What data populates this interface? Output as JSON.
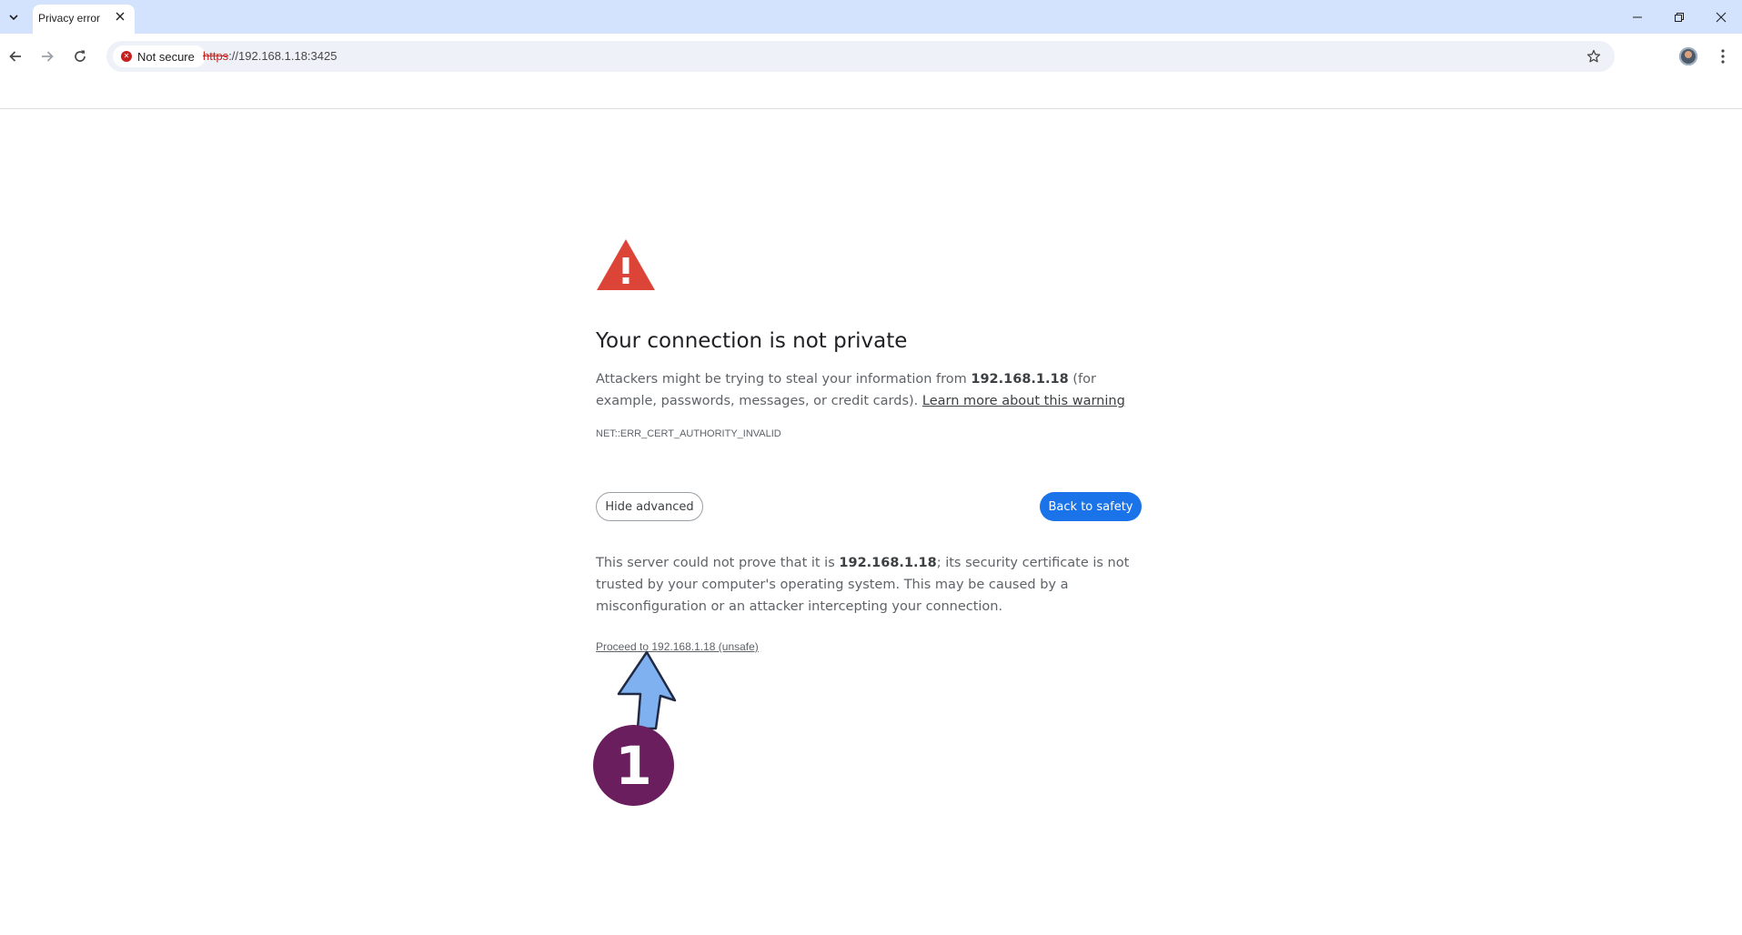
{
  "browser": {
    "tab": {
      "title": "Privacy error"
    },
    "security_chip": {
      "label": "Not secure",
      "color": "#c5221f"
    },
    "address": {
      "scheme": "https",
      "rest": "://192.168.1.18:3425"
    },
    "icons": {
      "tab_search": "chevron-down-icon",
      "tab_close": "close-icon",
      "back": "back-arrow-icon",
      "forward": "forward-arrow-icon",
      "reload": "reload-icon",
      "bookmark": "star-icon",
      "menu": "kebab-menu-icon"
    }
  },
  "interstitial": {
    "heading": "Your connection is not private",
    "summary": {
      "before": "Attackers might be trying to steal your information from ",
      "host": "192.168.1.18",
      "after": " (for example, passwords, messages, or credit cards). ",
      "learn_more": "Learn more about this warning"
    },
    "error_code": "NET::ERR_CERT_AUTHORITY_INVALID",
    "hide_advanced_label": "Hide advanced",
    "back_to_safety_label": "Back to safety",
    "details": {
      "before": "This server could not prove that it is ",
      "host": "192.168.1.18",
      "after": "; its security certificate is not trusted by your computer's operating system. This may be caused by a misconfiguration or an attacker intercepting your connection."
    },
    "proceed_link": "Proceed to 192.168.1.18 (unsafe)",
    "warning_color": "#db4437",
    "primary_color": "#1a73e8"
  },
  "annotation": {
    "step_number": "1",
    "badge_color": "#6a1e5e",
    "arrow_color": "#7fb1f0"
  }
}
